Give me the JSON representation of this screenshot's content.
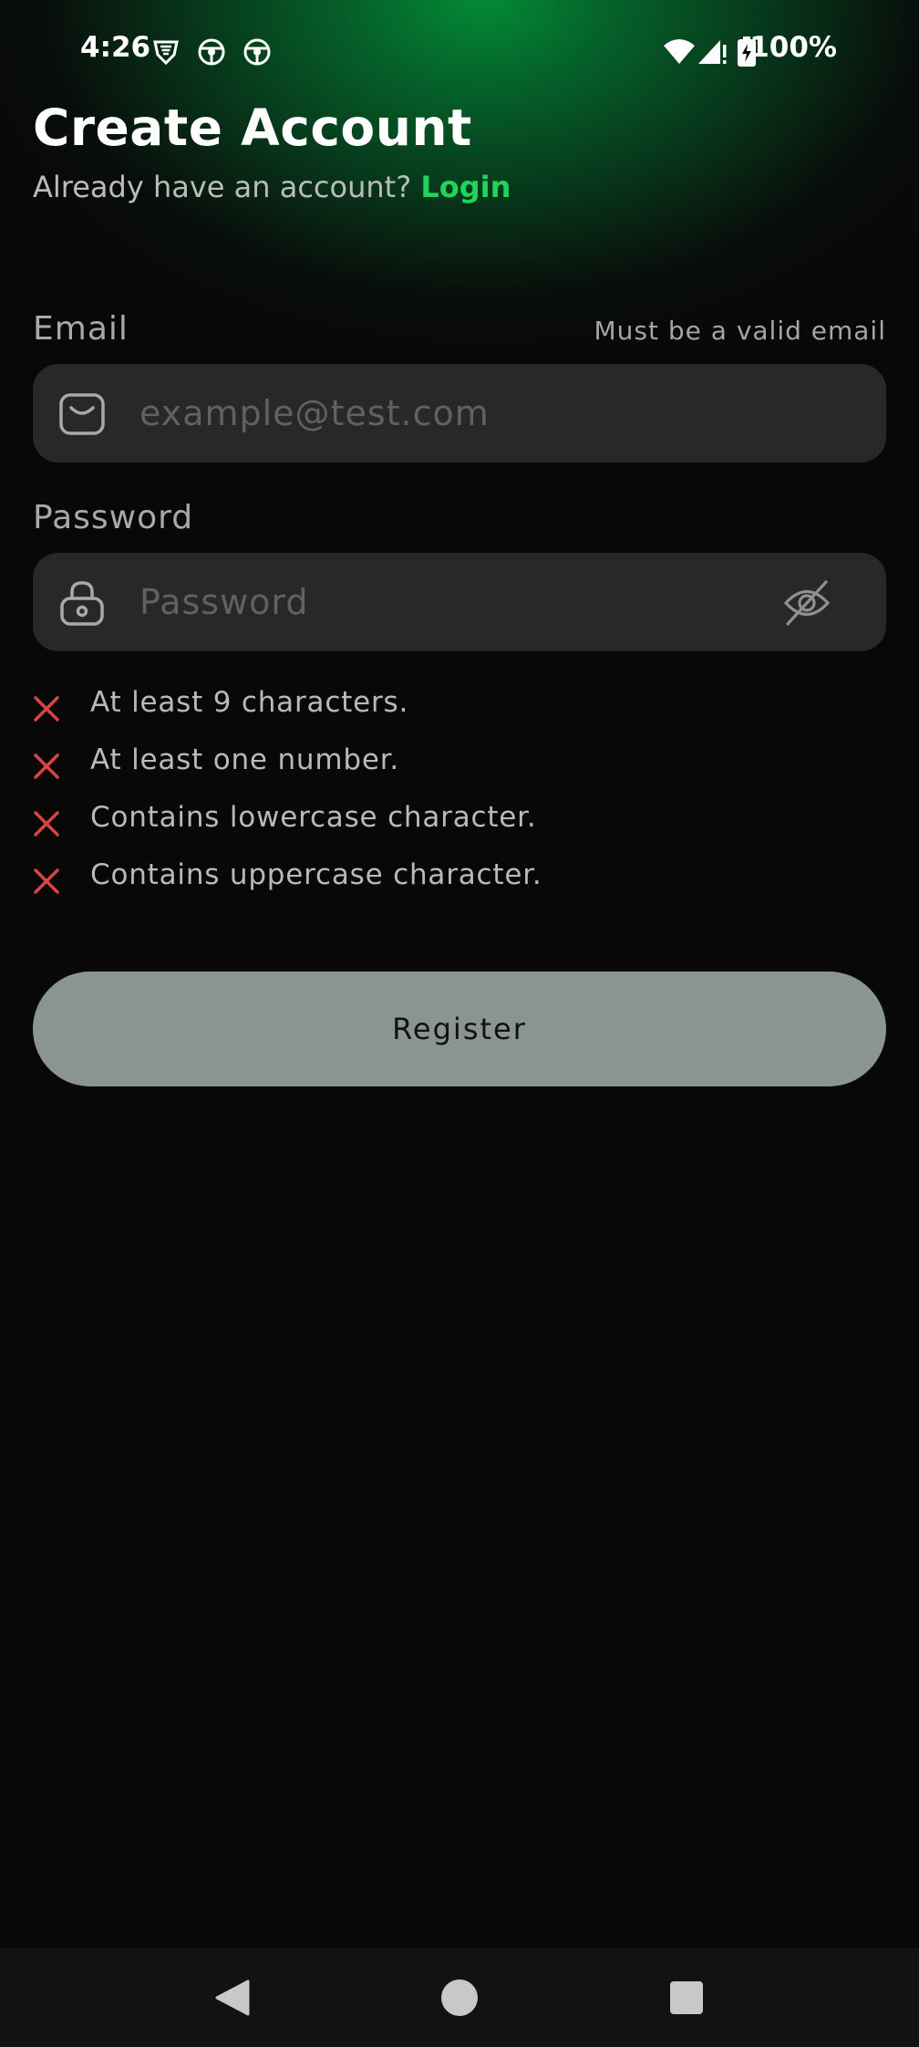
{
  "status_bar": {
    "time": "4:26",
    "battery": "100%",
    "left_icons": [
      "vpn-shield-icon",
      "steering-wheel-icon",
      "steering-wheel-icon"
    ],
    "right_icons": [
      "wifi-icon",
      "signal-icon",
      "battery-charging-icon"
    ]
  },
  "header": {
    "title": "Create Account",
    "subtitle_prefix": "Already have an account?",
    "login_link": "Login"
  },
  "email": {
    "label": "Email",
    "hint": "Must be a valid email",
    "placeholder": "example@test.com",
    "icon": "mail-icon"
  },
  "password": {
    "label": "Password",
    "placeholder": "Password",
    "icon": "lock-icon",
    "toggle_icon": "eye-off-icon"
  },
  "requirements": [
    {
      "text": "At least 9 characters.",
      "met": false
    },
    {
      "text": "At least one number.",
      "met": false
    },
    {
      "text": "Contains lowercase character.",
      "met": false
    },
    {
      "text": "Contains uppercase character.",
      "met": false
    }
  ],
  "register_button": "Register",
  "colors": {
    "accent": "#20d35a",
    "error": "#d84444",
    "button_disabled": "#8a9590",
    "input_bg": "#272828",
    "background": "#080808"
  },
  "nav": {
    "icons": [
      "back-triangle-icon",
      "home-circle-icon",
      "recents-square-icon"
    ]
  }
}
